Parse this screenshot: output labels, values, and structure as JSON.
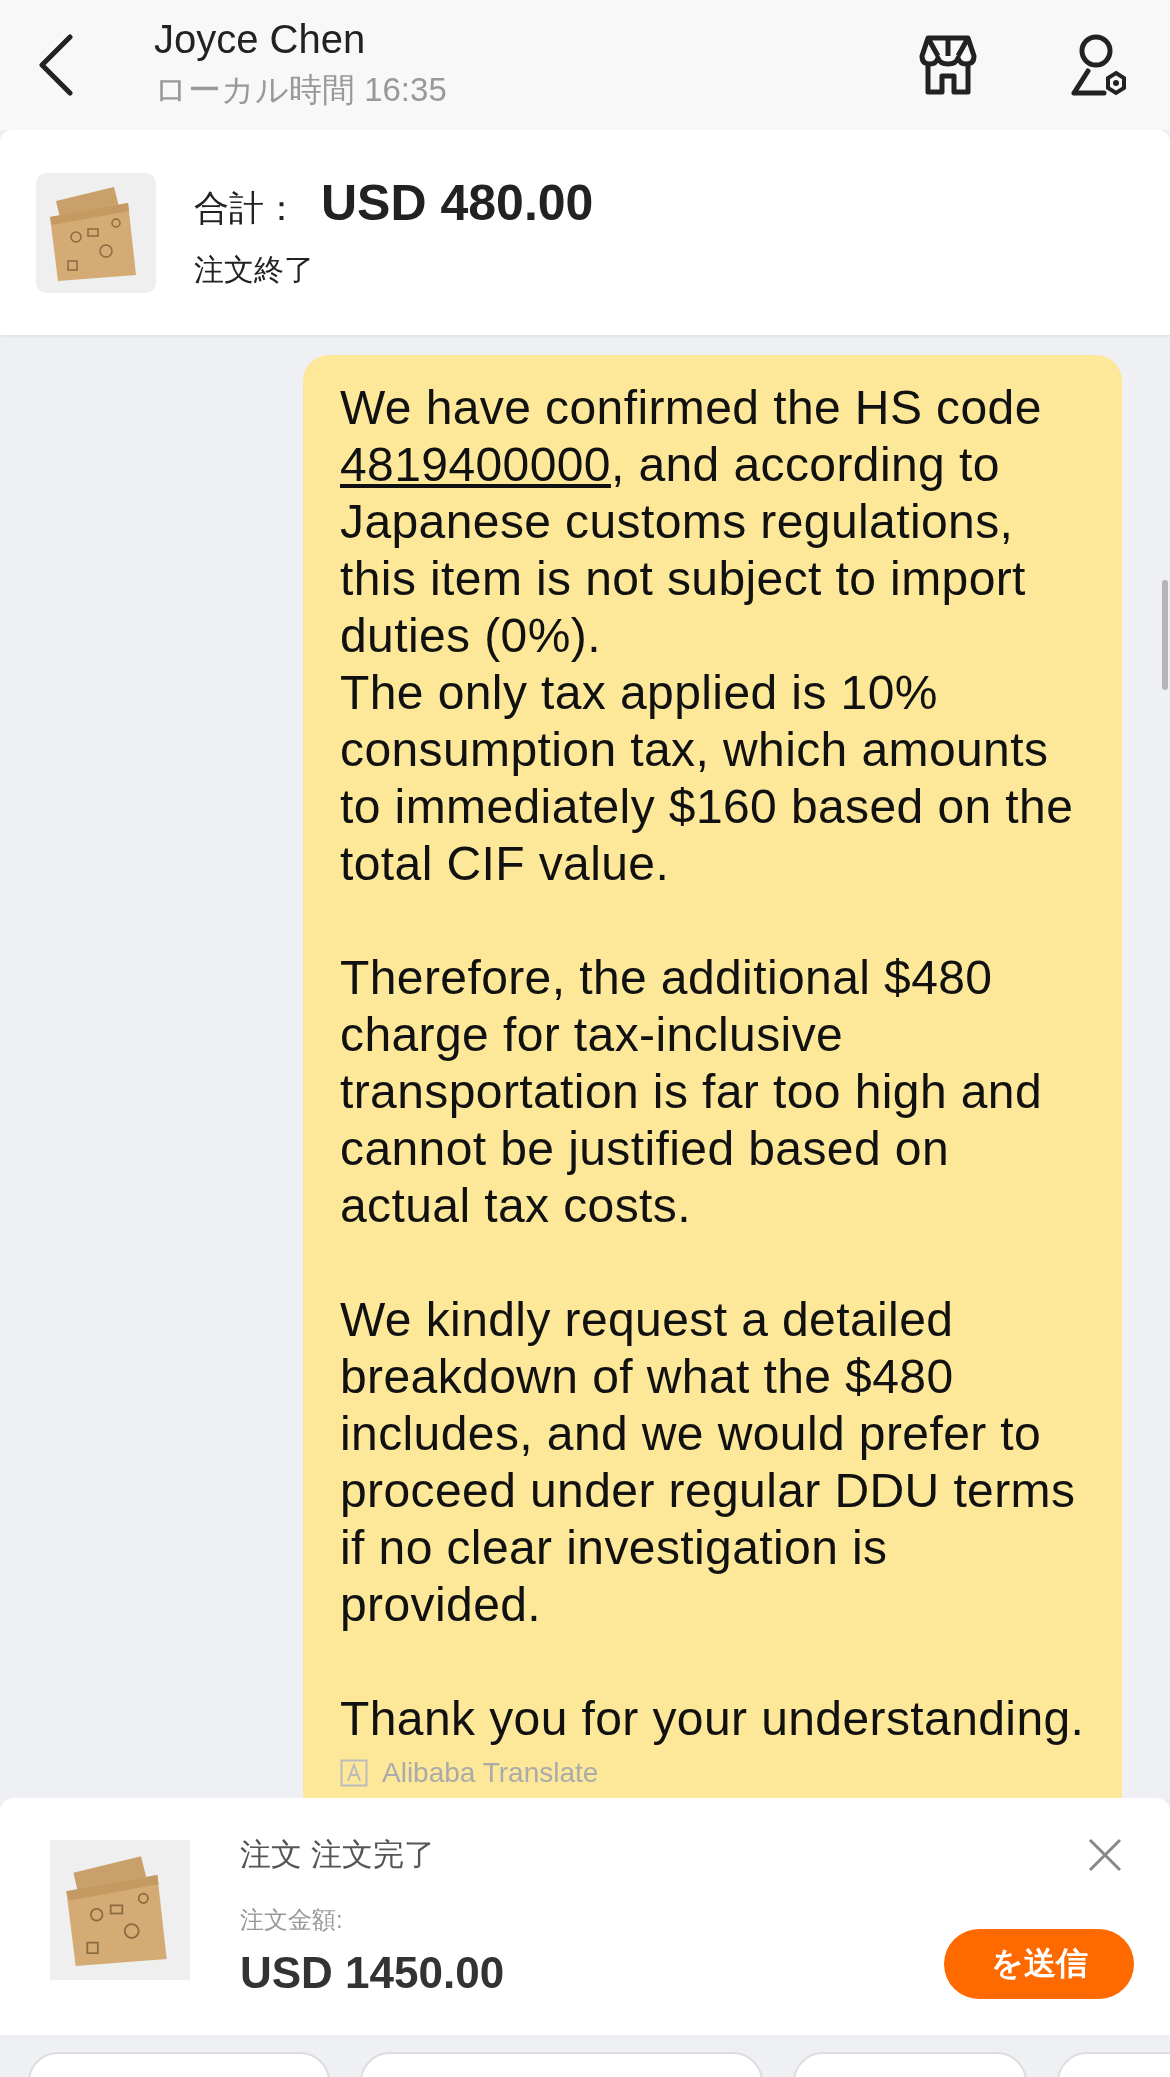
{
  "header": {
    "contact_name": "Joyce Chen",
    "local_time": "ローカル時間 16:35"
  },
  "order_summary": {
    "total_label": "合計：",
    "total": "USD 480.00",
    "status": "注文終了"
  },
  "message": {
    "blocks": [
      [
        {
          "before": "We have confirmed the HS code ",
          "link": "4819400000",
          "after": ", and according to Japanese customs regulations, this item is not subject to import duties (0%)."
        },
        {
          "text": "The only tax applied is 10% consumption tax, which amounts to immediately $160 based on the total CIF value."
        }
      ],
      [
        {
          "text": "Therefore, the additional $480 charge for tax-inclusive transportation is far too high and cannot be justified based on actual tax costs."
        }
      ],
      [
        {
          "text": "We kindly request a detailed breakdown of what the $480 includes, and we would prefer to proceed under regular DDU terms if no clear investigation is provided."
        }
      ],
      [
        {
          "text": "Thank you for your understanding."
        }
      ]
    ],
    "translation_label": "Alibaba Translate"
  },
  "order_panel": {
    "title": "注文 注文完了",
    "amount_label": "注文金額:",
    "amount": "USD 1450.00",
    "send_button": "を送信"
  },
  "quick_replies": [
    {
      "kind": "chip"
    },
    {
      "kind": "chip"
    },
    {
      "kind": "chip"
    },
    {
      "kind": "chip"
    }
  ]
}
